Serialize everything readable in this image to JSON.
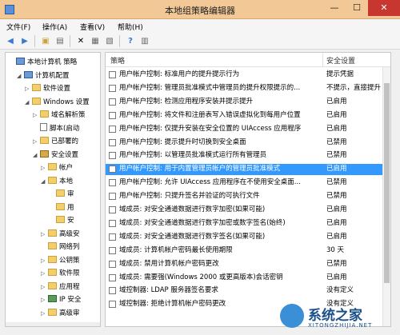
{
  "window": {
    "title": "本地组策略编辑器",
    "min": "—",
    "max": "☐",
    "close": "✕"
  },
  "menu": [
    "文件(F)",
    "操作(A)",
    "查看(V)",
    "帮助(H)"
  ],
  "tree": [
    {
      "label": "本地计算机 策略",
      "level": 0,
      "arrow": "",
      "icon": "comp"
    },
    {
      "label": "计算机配置",
      "level": 1,
      "arrow": "◢",
      "icon": "comp"
    },
    {
      "label": "软件设置",
      "level": 2,
      "arrow": "▷",
      "icon": "folder"
    },
    {
      "label": "Windows 设置",
      "level": 2,
      "arrow": "◢",
      "icon": "folder"
    },
    {
      "label": "域名解析策",
      "level": 3,
      "arrow": "▷",
      "icon": "folder"
    },
    {
      "label": "脚本(启动",
      "level": 3,
      "arrow": "",
      "icon": "doc"
    },
    {
      "label": "已部署的",
      "level": 3,
      "arrow": "▷",
      "icon": "folder"
    },
    {
      "label": "安全设置",
      "level": 3,
      "arrow": "◢",
      "icon": "lock"
    },
    {
      "label": "帐户",
      "level": 4,
      "arrow": "▷",
      "icon": "folder"
    },
    {
      "label": "本地",
      "level": 4,
      "arrow": "◢",
      "icon": "folder"
    },
    {
      "label": "审",
      "level": 5,
      "arrow": "",
      "icon": "folder"
    },
    {
      "label": "用",
      "level": 5,
      "arrow": "",
      "icon": "folder"
    },
    {
      "label": "安",
      "level": 5,
      "arrow": "",
      "icon": "folder"
    },
    {
      "label": "高级安",
      "level": 4,
      "arrow": "▷",
      "icon": "folder"
    },
    {
      "label": "网络列",
      "level": 4,
      "arrow": "",
      "icon": "folder"
    },
    {
      "label": "公钥策",
      "level": 4,
      "arrow": "▷",
      "icon": "folder"
    },
    {
      "label": "软件限",
      "level": 4,
      "arrow": "▷",
      "icon": "folder"
    },
    {
      "label": "应用程",
      "level": 4,
      "arrow": "▷",
      "icon": "folder"
    },
    {
      "label": "IP 安全",
      "level": 4,
      "arrow": "▷",
      "icon": "net"
    },
    {
      "label": "高级审",
      "level": 4,
      "arrow": "▷",
      "icon": "folder"
    }
  ],
  "list": {
    "col_policy": "策略",
    "col_setting": "安全设置",
    "rows": [
      {
        "policy": "用户帐户控制: 标准用户的提升提示行为",
        "setting": "提示凭据"
      },
      {
        "policy": "用户帐户控制: 管理员批准模式中管理员的提升权限提示的...",
        "setting": "不提示，直接提升"
      },
      {
        "policy": "用户帐户控制: 检测应用程序安装并提示提升",
        "setting": "已启用"
      },
      {
        "policy": "用户帐户控制: 将文件和注册表写入错误虚拟化到每用户位置",
        "setting": "已启用"
      },
      {
        "policy": "用户帐户控制: 仅提升安装在安全位置的 UIAccess 应用程序",
        "setting": "已启用"
      },
      {
        "policy": "用户帐户控制: 提示提升时切换到安全桌面",
        "setting": "已禁用"
      },
      {
        "policy": "用户帐户控制: 以管理员批准模式运行所有管理员",
        "setting": "已禁用"
      },
      {
        "policy": "用户帐户控制: 用于内置管理员帐户的管理员批准模式",
        "setting": "已启用",
        "selected": true
      },
      {
        "policy": "用户帐户控制: 允许 UIAccess 应用程序在不使用安全桌面...",
        "setting": "已禁用"
      },
      {
        "policy": "用户帐户控制: 只提升签名并验证的可执行文件",
        "setting": "已禁用"
      },
      {
        "policy": "域成员: 对安全通道数据进行数字加密(如果可能)",
        "setting": "已启用"
      },
      {
        "policy": "域成员: 对安全通道数据进行数字加密或数字签名(始终)",
        "setting": "已启用"
      },
      {
        "policy": "域成员: 对安全通道数据进行数字签名(如果可能)",
        "setting": "已启用"
      },
      {
        "policy": "域成员: 计算机帐户密码最长使用期限",
        "setting": "30 天"
      },
      {
        "policy": "域成员: 禁用计算机帐户密码更改",
        "setting": "已禁用"
      },
      {
        "policy": "域成员: 需要强(Windows 2000 或更高版本)会话密钥",
        "setting": "已启用"
      },
      {
        "policy": "域控制器: LDAP 服务器签名要求",
        "setting": "没有定义"
      },
      {
        "policy": "域控制器: 拒绝计算机帐户密码更改",
        "setting": "没有定义"
      }
    ]
  },
  "watermark": {
    "text": "系统之家",
    "sub": "XITONGZHIJIA.NET"
  }
}
